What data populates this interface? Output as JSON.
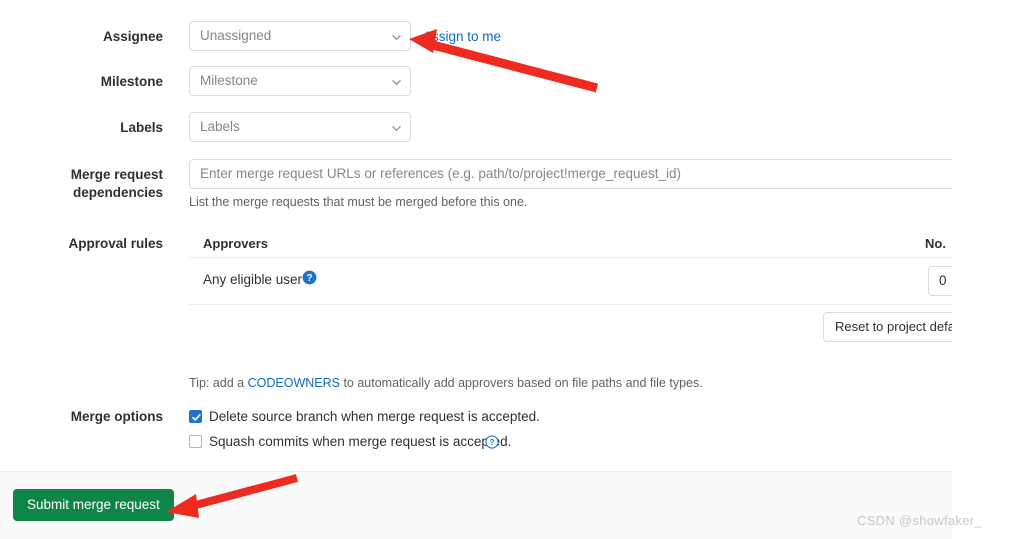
{
  "form": {
    "assignee": {
      "label": "Assignee",
      "value": "Unassigned",
      "assign_link": "Assign to me"
    },
    "milestone": {
      "label": "Milestone",
      "value": "Milestone"
    },
    "labels": {
      "label": "Labels",
      "value": "Labels"
    },
    "dependencies": {
      "label_line1": "Merge request",
      "label_line2": "dependencies",
      "placeholder": "Enter merge request URLs or references (e.g. path/to/project!merge_request_id)",
      "hint": "List the merge requests that must be merged before this one."
    },
    "approval_rules": {
      "label": "Approval rules",
      "columns": {
        "approvers": "Approvers",
        "number": "No."
      },
      "rows": [
        {
          "name": "Any eligible user",
          "help_icon": "help-circle-filled-icon",
          "approvals_required": "0"
        }
      ],
      "reset_button": "Reset to project defaults",
      "tip_prefix": "Tip: add a ",
      "tip_link": "CODEOWNERS",
      "tip_suffix": " to automatically add approvers based on file paths and file types."
    },
    "merge_options": {
      "label": "Merge options",
      "items": [
        {
          "label": "Delete source branch when merge request is accepted.",
          "checked": true,
          "help_icon": null
        },
        {
          "label": "Squash commits when merge request is accepted.",
          "checked": false,
          "help_icon": "help-circle-outline-icon"
        }
      ]
    }
  },
  "footer": {
    "submit_label": "Submit merge request"
  },
  "watermark": {
    "text": "CSDN @showfaker_"
  },
  "colors": {
    "link": "#1068bf",
    "submit_green": "#108548",
    "checkbox_blue": "#1f75cb",
    "annotation_red": "#ee2b20",
    "border": "#dbdbdb",
    "placeholder_text": "#868686"
  },
  "annotations": [
    {
      "name": "arrow-to-assignee-dropdown",
      "color": "#ee2b20"
    },
    {
      "name": "arrow-to-submit-button",
      "color": "#ee2b20"
    }
  ]
}
